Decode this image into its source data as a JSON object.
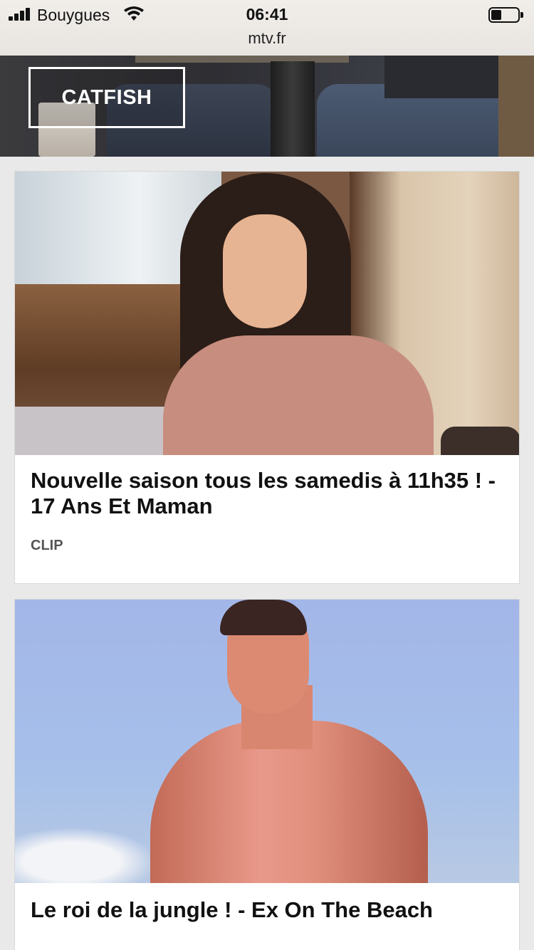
{
  "status_bar": {
    "carrier": "Bouygues",
    "time": "06:41",
    "url": "mtv.fr",
    "signal_icon": "signal-bars-icon",
    "wifi_icon": "wifi-icon",
    "battery_icon": "battery-icon",
    "battery_level": 0.4
  },
  "hero": {
    "button_label": "CATFISH"
  },
  "cards": [
    {
      "title": "Nouvelle saison tous les samedis à 11h35 ! - 17 Ans Et Maman",
      "tag": "CLIP"
    },
    {
      "title": "Le roi de la jungle ! - Ex On The Beach"
    }
  ]
}
